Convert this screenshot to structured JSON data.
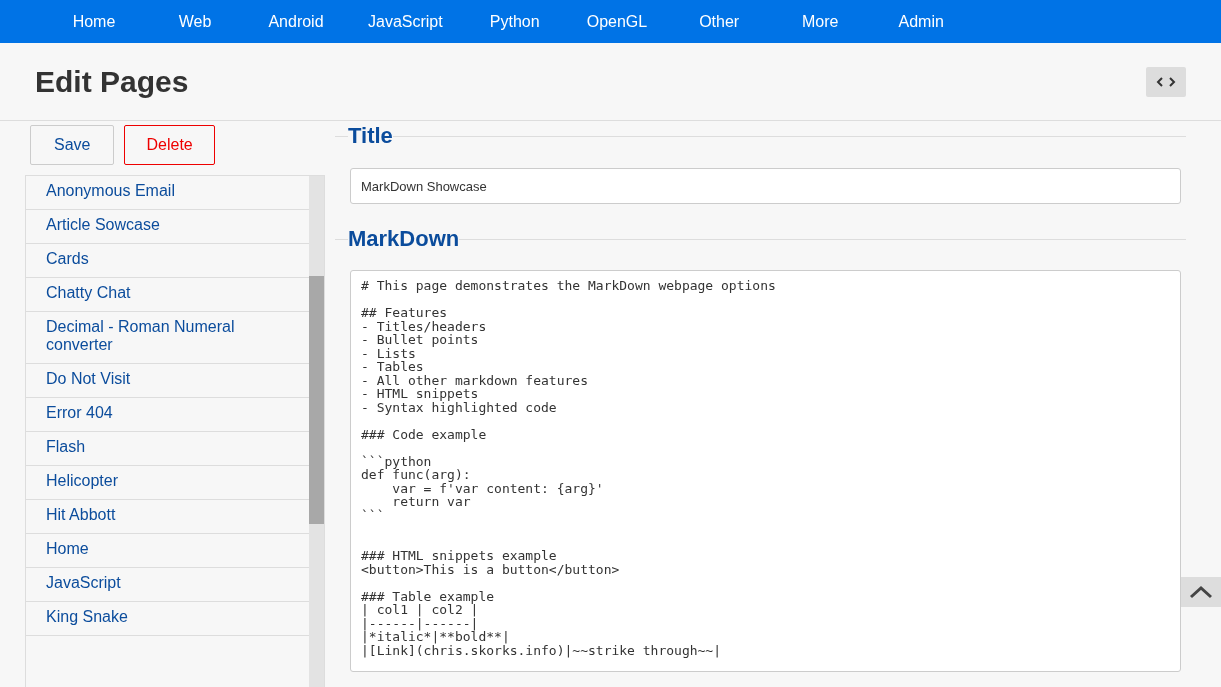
{
  "nav": [
    "Home",
    "Web",
    "Android",
    "JavaScript",
    "Python",
    "OpenGL",
    "Other",
    "More",
    "Admin"
  ],
  "page_title": "Edit Pages",
  "buttons": {
    "save": "Save",
    "delete": "Delete"
  },
  "pages": [
    "Anonymous Email",
    "Article Sowcase",
    "Cards",
    "Chatty Chat",
    "Decimal - Roman Numeral converter",
    "Do Not Visit",
    "Error 404",
    "Flash",
    "Helicopter",
    "Hit Abbott",
    "Home",
    "JavaScript",
    "King Snake"
  ],
  "title_section": {
    "heading": "Title",
    "value": "MarkDown Showcase"
  },
  "markdown_section": {
    "heading": "MarkDown",
    "value": "# This page demonstrates the MarkDown webpage options\n\n## Features\n- Titles/headers\n- Bullet points\n- Lists\n- Tables\n- All other markdown features\n- HTML snippets\n- Syntax highlighted code\n\n### Code example\n\n```python\ndef func(arg):\n    var = f'var content: {arg}'\n    return var\n```\n\n\n### HTML snippets example\n<button>This is a button</button>\n\n### Table example\n| col1 | col2 |\n|------|------|\n|*italic*|**bold**|\n|[Link](chris.skorks.info)|~~strike through~~|"
  }
}
